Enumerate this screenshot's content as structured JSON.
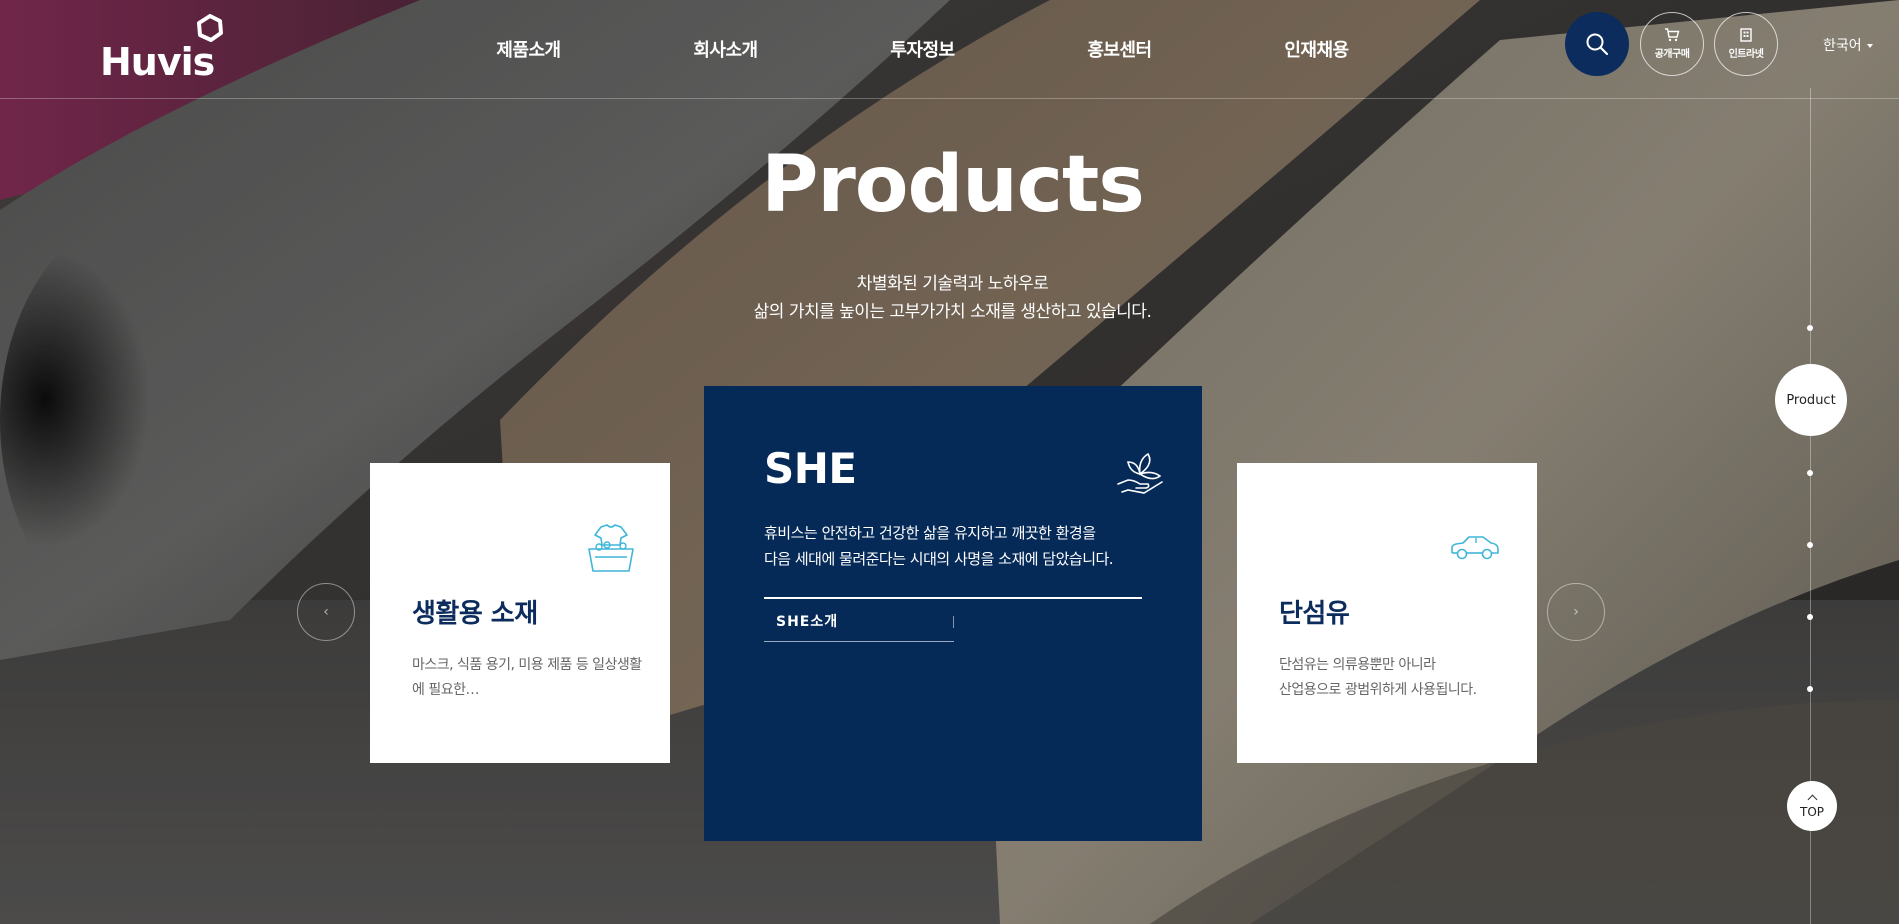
{
  "brand": {
    "logo_text": "Huvis",
    "accent": "#052a58",
    "icon_color": "#3fb6d9"
  },
  "nav": {
    "items": [
      "제품소개",
      "회사소개",
      "투자정보",
      "홍보센터",
      "인재채용"
    ]
  },
  "utility": {
    "search_icon": "search-icon",
    "purchase_label": "공개구매",
    "intranet_label": "인트라넷",
    "language": "한국어"
  },
  "hero": {
    "title": "Products",
    "desc_line1": "차별화된 기술력과 노하우로",
    "desc_line2": "삶의 가치를 높이는 고부가가치 소재를 생산하고 있습니다."
  },
  "cards": {
    "left": {
      "title": "생활용 소재",
      "text": "마스크, 식품 용기, 미용 제품 등 일상생활에 필요한…",
      "icon": "laundry-basket-icon"
    },
    "center": {
      "title": "SHE",
      "text_line1": "휴비스는 안전하고 건강한 삶을 유지하고 깨끗한 환경을",
      "text_line2": "다음 세대에 물려준다는 시대의 사명을 소재에 담았습니다.",
      "link_label": "SHE소개",
      "icon": "hand-leaf-icon"
    },
    "right": {
      "title": "단섬유",
      "text_line1": "단섬유는 의류용뿐만 아니라",
      "text_line2": "산업용으로 광범위하게 사용됩니다.",
      "icon": "car-icon"
    }
  },
  "carousel": {
    "prev": "‹",
    "next": "›"
  },
  "side_nav": {
    "active_label": "Product",
    "top_label": "TOP"
  }
}
